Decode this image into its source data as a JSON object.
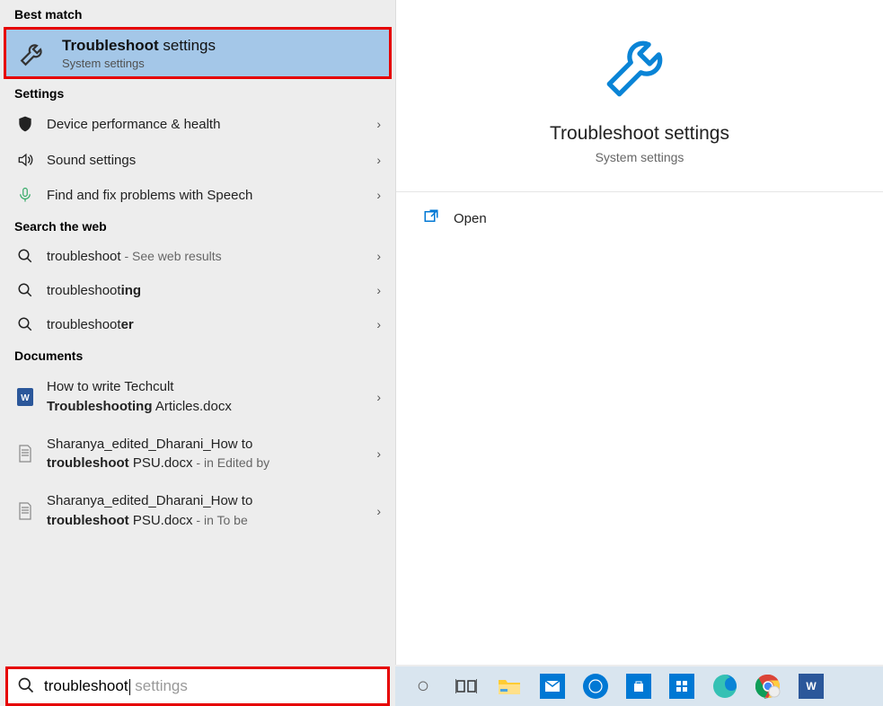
{
  "sections": {
    "best_match_header": "Best match",
    "settings_header": "Settings",
    "web_header": "Search the web",
    "documents_header": "Documents"
  },
  "best_match": {
    "title_bold": "Troubleshoot",
    "title_rest": " settings",
    "subtitle": "System settings"
  },
  "settings_items": [
    {
      "icon": "shield-icon",
      "label": "Device performance & health"
    },
    {
      "icon": "speaker-icon",
      "label": "Sound settings"
    },
    {
      "icon": "mic-icon",
      "label": "Find and fix problems with Speech"
    }
  ],
  "web_items": [
    {
      "prefix": "troubleshoot",
      "suffix": "",
      "tail": " - See web results"
    },
    {
      "prefix": "troubleshoot",
      "suffix": "ing",
      "tail": ""
    },
    {
      "prefix": "troubleshoot",
      "suffix": "er",
      "tail": ""
    }
  ],
  "documents": [
    {
      "line1_a": "How to write Techcult ",
      "line1_b": "",
      "line2_a": "Troubleshooting",
      "line2_b": " Articles.docx",
      "tail": ""
    },
    {
      "line1_a": "Sharanya_edited_Dharani_How to ",
      "line1_b": "",
      "line2_a": "troubleshoot",
      "line2_b": " PSU.docx",
      "tail": " - in Edited by"
    },
    {
      "line1_a": "Sharanya_edited_Dharani_How to ",
      "line1_b": "",
      "line2_a": "troubleshoot",
      "line2_b": " PSU.docx",
      "tail": " - in To be"
    }
  ],
  "search": {
    "typed": "troubleshoot",
    "hint": " settings"
  },
  "preview": {
    "title": "Troubleshoot settings",
    "subtitle": "System settings",
    "open_label": "Open"
  },
  "taskbar": {
    "cortana": "○",
    "word": "W"
  }
}
